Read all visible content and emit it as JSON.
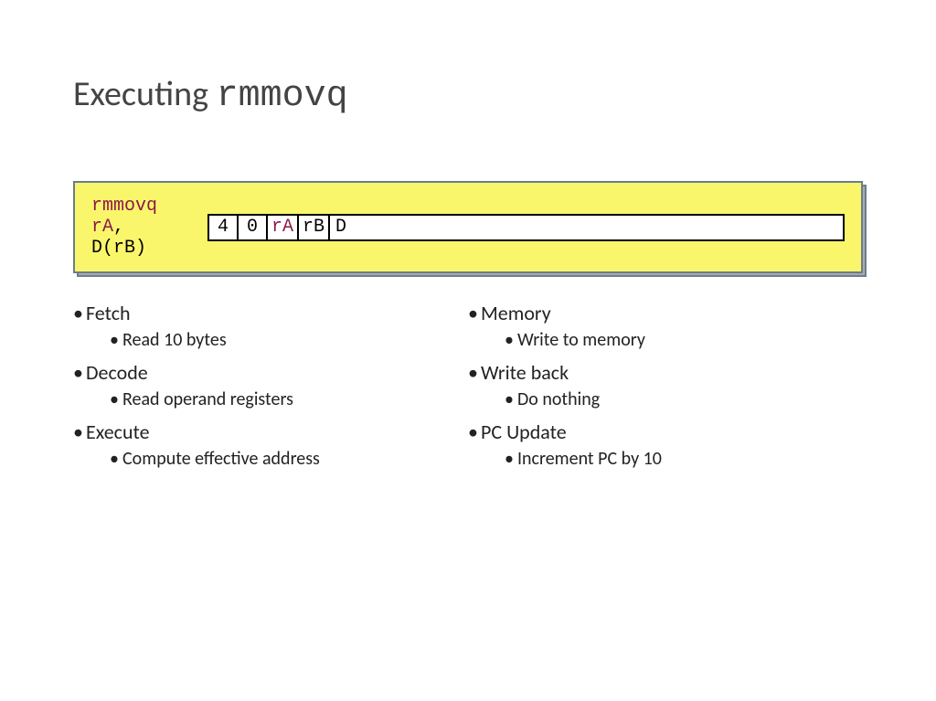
{
  "title": {
    "prefix": "Executing ",
    "instruction": "rmmovq"
  },
  "encoding": {
    "mnemonic": "rmmovq",
    "operands": {
      "rA": "rA",
      "sep1": ", ",
      "D": "D",
      "lparen": "(",
      "rB": "rB",
      "rparen": ")"
    },
    "bytes": {
      "icode": "4",
      "ifun": "0",
      "rA": "rA",
      "rB": "rB",
      "D": "D"
    }
  },
  "left": {
    "stages": [
      {
        "name": "Fetch",
        "detail": "Read 10 bytes"
      },
      {
        "name": "Decode",
        "detail": "Read operand registers"
      },
      {
        "name": "Execute",
        "detail": "Compute effective address"
      }
    ]
  },
  "right": {
    "stages": [
      {
        "name": "Memory",
        "detail": "Write to memory"
      },
      {
        "name": "Write back",
        "detail": "Do nothing"
      },
      {
        "name": "PC Update",
        "detail": "Increment PC by 10"
      }
    ]
  }
}
